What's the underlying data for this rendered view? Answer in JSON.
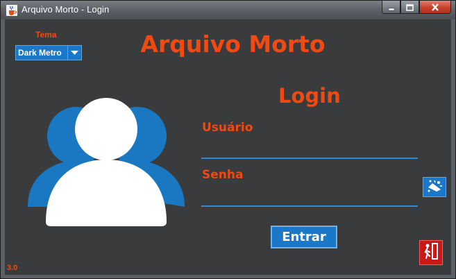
{
  "window": {
    "title": "Arquivo Morto - Login",
    "app_icon": "java-cup-icon"
  },
  "window_buttons": {
    "minimize": "minimize-icon",
    "maximize": "maximize-icon",
    "close": "close-icon"
  },
  "theme": {
    "label": "Tema",
    "selected": "Dark Metro"
  },
  "app_title": "Arquivo Morto",
  "login": {
    "title": "Login",
    "username_label": "Usuário",
    "username_value": "",
    "password_label": "Senha",
    "password_value": "",
    "enter_label": "Entrar"
  },
  "version": "3.0",
  "colors": {
    "accent_orange": "#f04a12",
    "accent_blue": "#1b78c9",
    "background": "#3a3b3d",
    "exit_red": "#c81818"
  },
  "icons": {
    "avatar": "users-icon",
    "show_password": "show-password-icon",
    "exit": "exit-door-icon",
    "dropdown": "chevron-down-icon"
  }
}
